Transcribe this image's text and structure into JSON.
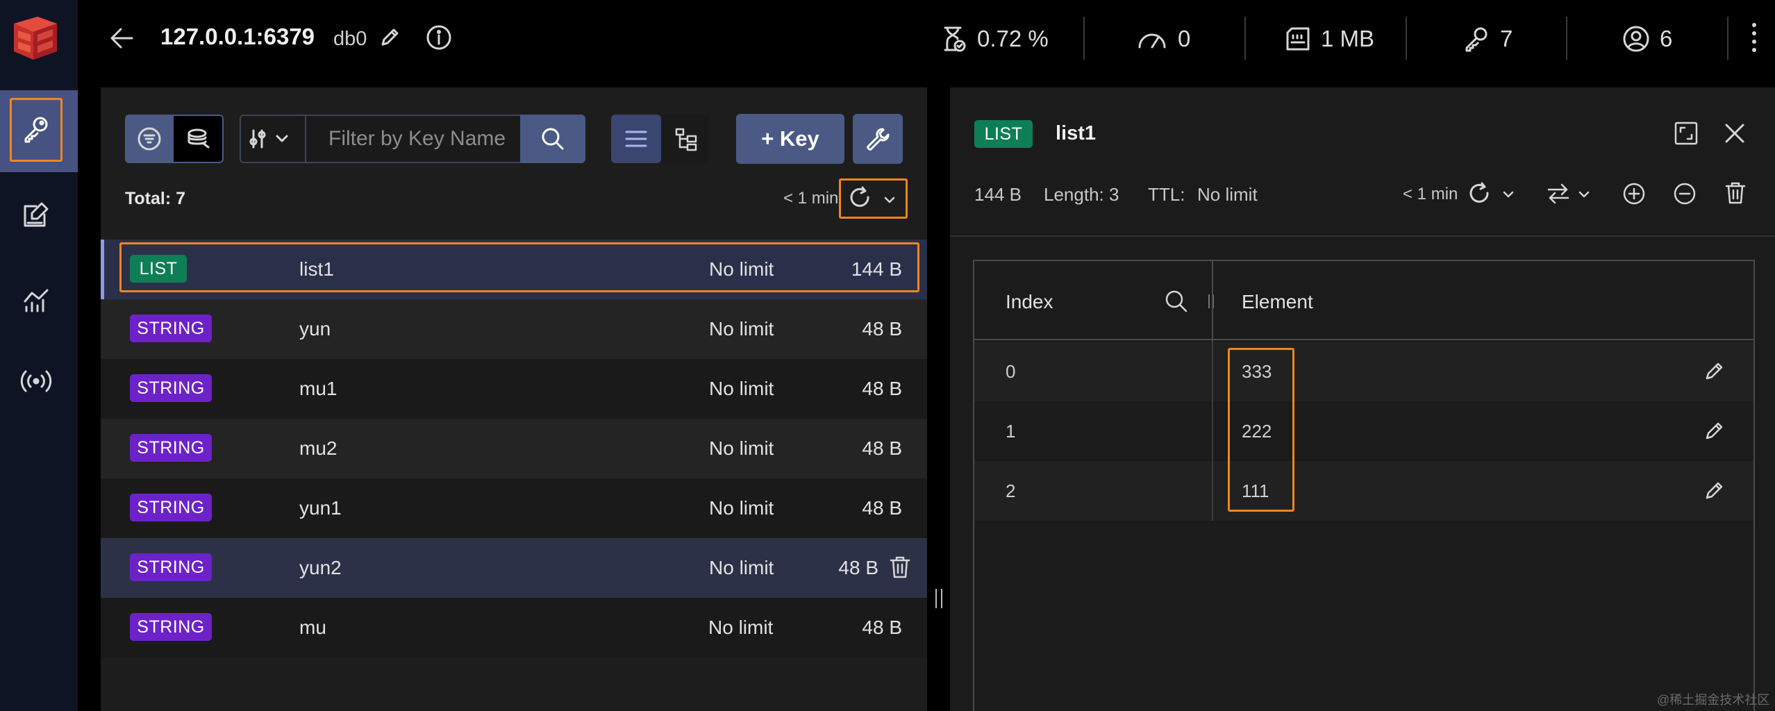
{
  "header": {
    "host": "127.0.0.1:6379",
    "db": "db0",
    "stats": {
      "cpu": "0.72 %",
      "ops": "0",
      "memory": "1 MB",
      "keys": "7",
      "clients": "6"
    }
  },
  "nav": {
    "items": [
      "key-browser",
      "workbench",
      "analysis",
      "pub-sub"
    ]
  },
  "browser": {
    "filter_placeholder": "Filter by Key Name",
    "add_key_label": "+ Key",
    "total_label": "Total: 7",
    "refresh_label": "< 1 min",
    "keys": [
      {
        "type": "LIST",
        "name": "list1",
        "ttl": "No limit",
        "size": "144 B"
      },
      {
        "type": "STRING",
        "name": "yun",
        "ttl": "No limit",
        "size": "48 B"
      },
      {
        "type": "STRING",
        "name": "mu1",
        "ttl": "No limit",
        "size": "48 B"
      },
      {
        "type": "STRING",
        "name": "mu2",
        "ttl": "No limit",
        "size": "48 B"
      },
      {
        "type": "STRING",
        "name": "yun1",
        "ttl": "No limit",
        "size": "48 B"
      },
      {
        "type": "STRING",
        "name": "yun2",
        "ttl": "No limit",
        "size": "48 B"
      },
      {
        "type": "STRING",
        "name": "mu",
        "ttl": "No limit",
        "size": "48 B"
      }
    ]
  },
  "details": {
    "type": "LIST",
    "key_name": "list1",
    "size": "144 B",
    "length": "Length: 3",
    "ttl_label": "TTL:",
    "ttl_value": "No limit",
    "refresh_label": "< 1 min",
    "columns": {
      "index": "Index",
      "element": "Element"
    },
    "rows": [
      {
        "index": "0",
        "element": "333"
      },
      {
        "index": "1",
        "element": "222"
      },
      {
        "index": "2",
        "element": "111"
      }
    ]
  },
  "watermark": "@稀土掘金技术社区",
  "colors": {
    "accent_orange": "#f0861e",
    "list_tag": "#0e7e56",
    "string_tag": "#6c22c8",
    "primary_button": "#4a5a85"
  }
}
